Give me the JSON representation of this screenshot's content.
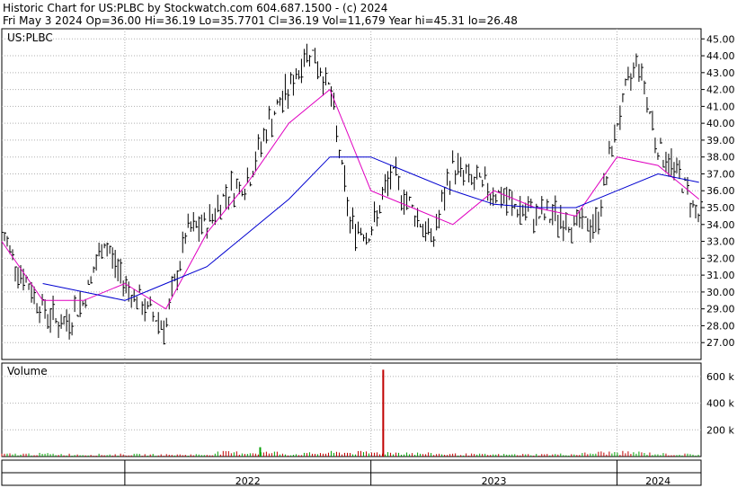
{
  "header": {
    "line1": "Historic Chart for US:PLBC by Stockwatch.com 604.687.1500 - (c) 2024",
    "line2": "Fri May  3 2024   Op=36.00   Hi=36.19   Lo=35.7701   Cl=36.19   Vol=11,679   Year hi=45.31   lo=26.48"
  },
  "colors": {
    "price_bars": "#000000",
    "ma_short": "#e000c0",
    "ma_long": "#0000d0",
    "volume_up": "#00a000",
    "volume_down": "#c00000",
    "grid": "#b0b0b0"
  },
  "chart_data": [
    {
      "type": "line",
      "panel": "price",
      "symbol_label": "US:PLBC",
      "ylim": [
        26,
        45.6
      ],
      "y_ticks": [
        "27.00",
        "28.00",
        "29.00",
        "30.00",
        "31.00",
        "32.00",
        "33.00",
        "34.00",
        "35.00",
        "36.00",
        "37.00",
        "38.00",
        "39.00",
        "40.00",
        "41.00",
        "42.00",
        "43.00",
        "44.00",
        "45.00"
      ],
      "x_labels": [
        "2022",
        "2023",
        "2024"
      ],
      "x_range": [
        "2021-07",
        "2024-05"
      ],
      "grid": true,
      "series": [
        {
          "kind": "ohlc-bars",
          "x": [
            "2021-07",
            "2021-08",
            "2021-09",
            "2021-10",
            "2021-11",
            "2021-12",
            "2022-01",
            "2022-02",
            "2022-03",
            "2022-04",
            "2022-05",
            "2022-06",
            "2022-07",
            "2022-08",
            "2022-09",
            "2022-10",
            "2022-11",
            "2022-12",
            "2023-01",
            "2023-02",
            "2023-03",
            "2023-04",
            "2023-05",
            "2023-06",
            "2023-07",
            "2023-08",
            "2023-09",
            "2023-10",
            "2023-11",
            "2023-12",
            "2024-01",
            "2024-02",
            "2024-03",
            "2024-04",
            "2024-05"
          ],
          "values": [
            33.5,
            31.0,
            29.0,
            28.0,
            29.5,
            33.0,
            30.5,
            29.0,
            28.0,
            33.5,
            34.0,
            36.0,
            36.5,
            40.0,
            42.0,
            44.5,
            42.0,
            34.0,
            33.5,
            37.0,
            35.0,
            33.0,
            37.5,
            36.5,
            36.0,
            35.0,
            34.5,
            34.5,
            34.0,
            34.0,
            40.0,
            44.0,
            38.5,
            37.0,
            34.5
          ]
        },
        {
          "name": "",
          "kind": "moving-average-short",
          "x": [
            "2021-07",
            "2021-09",
            "2021-11",
            "2022-01",
            "2022-03",
            "2022-05",
            "2022-07",
            "2022-09",
            "2022-11",
            "2023-01",
            "2023-03",
            "2023-05",
            "2023-07",
            "2023-09",
            "2023-11",
            "2024-01",
            "2024-03",
            "2024-05"
          ],
          "values": [
            33.0,
            29.5,
            29.5,
            30.5,
            29.0,
            33.5,
            36.5,
            40.0,
            42.0,
            36.0,
            35.0,
            34.0,
            36.0,
            35.0,
            34.5,
            38.0,
            37.5,
            35.5
          ]
        },
        {
          "name": "",
          "kind": "moving-average-long",
          "x": [
            "2021-09",
            "2021-11",
            "2022-01",
            "2022-03",
            "2022-05",
            "2022-07",
            "2022-09",
            "2022-11",
            "2023-01",
            "2023-03",
            "2023-05",
            "2023-07",
            "2023-09",
            "2023-11",
            "2024-01",
            "2024-03",
            "2024-05"
          ],
          "values": [
            30.5,
            30.0,
            29.5,
            30.5,
            31.5,
            33.5,
            35.5,
            38.0,
            38.0,
            37.0,
            36.0,
            35.2,
            35.0,
            35.0,
            36.0,
            37.0,
            36.5
          ]
        }
      ]
    },
    {
      "type": "bar",
      "panel": "volume",
      "title": "Volume",
      "ylim": [
        0,
        700000
      ],
      "y_ticks": [
        "200 k",
        "400 k",
        "600 k"
      ],
      "x": [
        "2021-07",
        "2021-09",
        "2021-11",
        "2022-01",
        "2022-03",
        "2022-05",
        "2022-07",
        "2022-09",
        "2022-11",
        "2023-01",
        "2023-03",
        "2023-05",
        "2023-07",
        "2023-09",
        "2023-11",
        "2024-01",
        "2024-03",
        "2024-05"
      ],
      "values": [
        18000,
        20000,
        15000,
        16000,
        14000,
        15000,
        70000,
        16000,
        30000,
        650000,
        25000,
        18000,
        15000,
        16000,
        18000,
        40000,
        20000,
        15000
      ]
    }
  ]
}
